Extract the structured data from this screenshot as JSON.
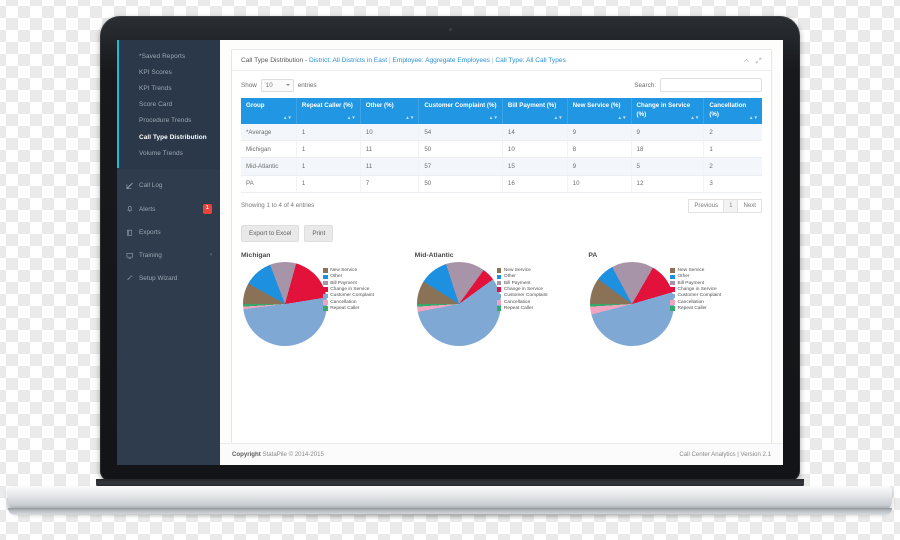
{
  "sidebar": {
    "submenu": [
      {
        "label": "*Saved Reports",
        "active": false
      },
      {
        "label": "KPI Scores",
        "active": false
      },
      {
        "label": "KPI Trends",
        "active": false
      },
      {
        "label": "Score Card",
        "active": false
      },
      {
        "label": "Procedure Trends",
        "active": false
      },
      {
        "label": "Call Type Distribution",
        "active": true
      },
      {
        "label": "Volume Trends",
        "active": false
      }
    ],
    "menu": [
      {
        "label": "Call Log",
        "icon": "pencil-square-icon",
        "badge": "",
        "caret": ""
      },
      {
        "label": "Alerts",
        "icon": "bell-icon",
        "badge": "1",
        "caret": ""
      },
      {
        "label": "Exports",
        "icon": "book-icon",
        "badge": "",
        "caret": ""
      },
      {
        "label": "Training",
        "icon": "monitor-icon",
        "badge": "",
        "caret": "‹"
      },
      {
        "label": "Setup Wizard",
        "icon": "wand-icon",
        "badge": "",
        "caret": ""
      }
    ],
    "accent_color": "#1fbad6",
    "background_color": "#2e3c4e"
  },
  "panel": {
    "title_prefix": "Call Type Distribution - ",
    "filter_district": "District: All Districts in East",
    "sep1": " | ",
    "filter_employee": "Employee: Aggregate Employees",
    "sep2": " | ",
    "filter_calltype": "Call Type: All Call Types",
    "collapse_icon": "chevron-up-icon",
    "expand_icon": "expand-icon"
  },
  "table_controls": {
    "show_label": "Show",
    "entries_value": "10",
    "entries_label": "entries",
    "search_label": "Search:",
    "search_value": "",
    "search_placeholder": ""
  },
  "table": {
    "headers": [
      "Group",
      "Repeat Caller (%)",
      "Other (%)",
      "Customer Complaint (%)",
      "Bill Payment (%)",
      "New Service (%)",
      "Change in Service (%)",
      "Cancellation (%)"
    ],
    "rows": [
      [
        "*Average",
        "1",
        "10",
        "54",
        "14",
        "9",
        "9",
        "2"
      ],
      [
        "Michigan",
        "1",
        "11",
        "50",
        "10",
        "8",
        "18",
        "1"
      ],
      [
        "Mid-Atlantic",
        "1",
        "11",
        "57",
        "15",
        "9",
        "5",
        "2"
      ],
      [
        "PA",
        "1",
        "7",
        "50",
        "16",
        "10",
        "12",
        "3"
      ]
    ],
    "info": "Showing 1 to 4 of 4 entries",
    "pagination": {
      "previous": "Previous",
      "current": "1",
      "next": "Next"
    },
    "header_color": "#2196e3"
  },
  "buttons": {
    "export": "Export to Excel",
    "print": "Print"
  },
  "chart_data": [
    {
      "type": "pie",
      "title": "Michigan",
      "categories": [
        "New Service",
        "Other",
        "Bill Payment",
        "Change in Service",
        "Customer Complaint",
        "Cancellation",
        "Repeat Caller"
      ],
      "values": [
        8,
        11,
        10,
        18,
        50,
        1,
        1
      ],
      "colors": [
        "#8a7256",
        "#1e90e0",
        "#a894a8",
        "#e3123b",
        "#7fa8d4",
        "#f2a3bd",
        "#35a86b"
      ],
      "legend": "right",
      "unit": "%"
    },
    {
      "type": "pie",
      "title": "Mid-Atlantic",
      "categories": [
        "New Service",
        "Other",
        "Bill Payment",
        "Change in Service",
        "Customer Complaint",
        "Cancellation",
        "Repeat Caller"
      ],
      "values": [
        9,
        11,
        15,
        5,
        57,
        2,
        1
      ],
      "colors": [
        "#8a7256",
        "#1e90e0",
        "#a894a8",
        "#e3123b",
        "#7fa8d4",
        "#f2a3bd",
        "#35a86b"
      ],
      "legend": "right",
      "unit": "%"
    },
    {
      "type": "pie",
      "title": "PA",
      "categories": [
        "New Service",
        "Other",
        "Bill Payment",
        "Change in Service",
        "Customer Complaint",
        "Cancellation",
        "Repeat Caller"
      ],
      "values": [
        10,
        7,
        16,
        12,
        50,
        3,
        1
      ],
      "colors": [
        "#8a7256",
        "#1e90e0",
        "#a894a8",
        "#e3123b",
        "#7fa8d4",
        "#f2a3bd",
        "#35a86b"
      ],
      "legend": "right",
      "unit": "%"
    }
  ],
  "footer": {
    "copyright_label": "Copyright",
    "copyright_text": "StataPile © 2014-2015",
    "right_text": "Call Center Analytics | Version 2.1"
  }
}
